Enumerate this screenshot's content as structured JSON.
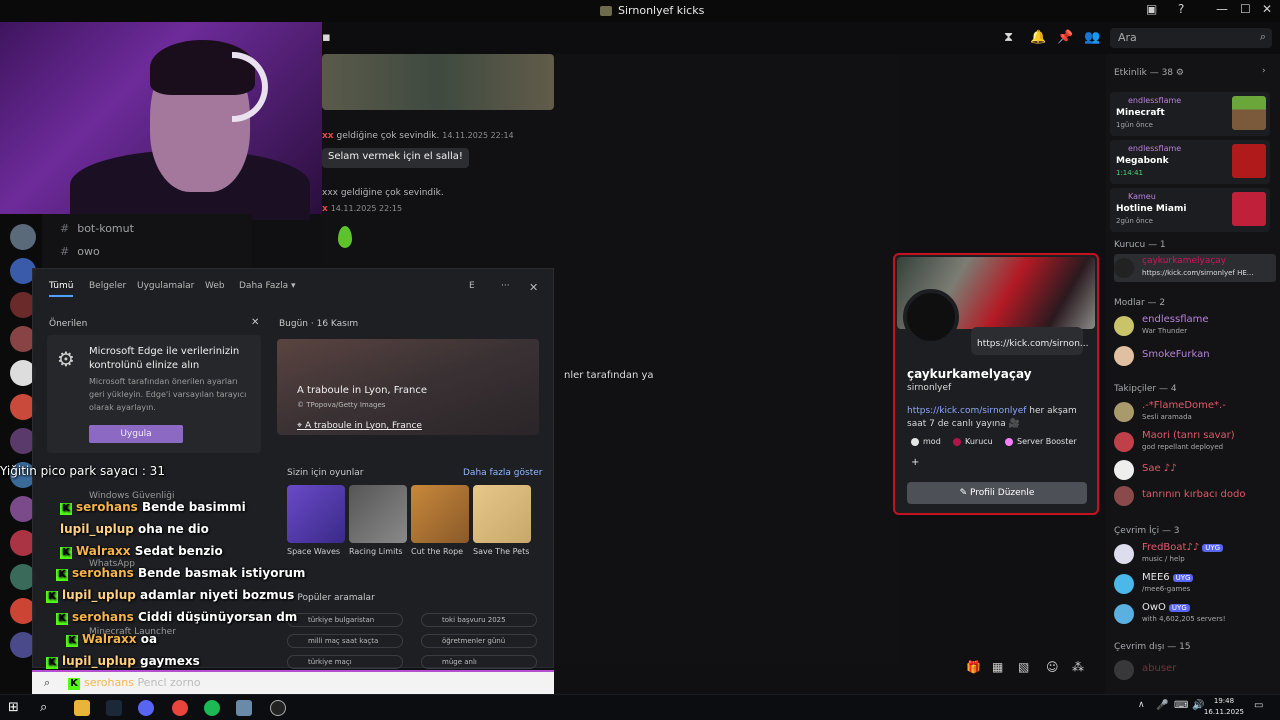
{
  "window": {
    "title": "Sirnonlyef kicks"
  },
  "toolbar": {
    "search_placeholder": "Ara"
  },
  "channels": [
    {
      "name": "bot-komut"
    },
    {
      "name": "owo"
    }
  ],
  "chat": {
    "line1_user": "xx",
    "line1_text": "geldiğine çok sevindik.",
    "line1_time": "14.11.2025 22:14",
    "wave_button": "Selam vermek için el salla!",
    "line2_text": "xxx geldiğine çok sevindik.",
    "line2_time": "14.11.2025 22:15",
    "partial_text": "nler tarafından ya"
  },
  "start_menu": {
    "tabs": [
      "Tümü",
      "Belgeler",
      "Uygulamalar",
      "Web",
      "Daha Fazla"
    ],
    "user_initial": "E",
    "recommended": "Önerilen",
    "edge_title": "Microsoft Edge ile verilerinizin kontrolünü elinize alın",
    "edge_desc": "Microsoft tarafından önerilen ayarları geri yükleyin. Edge'i varsayılan tarayıcı olarak ayarlayın.",
    "edge_button": "Uygula",
    "today": "Bugün",
    "today_date": "16 Kasım",
    "day_caption": "A traboule in Lyon, France",
    "day_credit": "© TPopova/Getty Images",
    "day_location": "A traboule in Lyon, France",
    "games_header": "Sizin için oyunlar",
    "show_more": "Daha fazla göster",
    "games": [
      "Space Waves",
      "Racing Limits",
      "Cut the Rope",
      "Save The Pets"
    ],
    "popular_header": "Popüler aramalar",
    "popular": [
      "türkiye bulgaristan",
      "toki başvuru 2025",
      "milli maç saat kaçta",
      "öğretmenler günü",
      "türkiye maçı",
      "müge anlı"
    ],
    "apps": [
      "Windows Güvenliği",
      "WhatsApp",
      "Minecraft Launcher"
    ]
  },
  "overlay": {
    "counter": "Yiğitin pico park sayacı : 31",
    "messages": [
      {
        "user": "serohans",
        "text": "Bende basimmi"
      },
      {
        "user": "lupil_uplup",
        "text": "oha ne dio"
      },
      {
        "user": "Walraxx",
        "text": "Sedat benzio"
      },
      {
        "user": "serohans",
        "text": "Bende basmak istiyorum"
      },
      {
        "user": "lupil_uplup",
        "text": "adamlar niyeti bozmus"
      },
      {
        "user": "serohans",
        "text": "Ciddi düşünüyorsan dm"
      },
      {
        "user": "Walraxx",
        "text": "oa"
      },
      {
        "user": "lupil_uplup",
        "text": "gaymexs"
      },
      {
        "user": "serohans",
        "text": "Pencl zorno"
      }
    ]
  },
  "profile": {
    "url_bubble": "https://kick.com/sirnon...",
    "display_name": "çaykurkamelyaçay",
    "username": "sirnonlyef",
    "bio_link": "https://kick.com/sirnonlyef",
    "bio_text": " her akşam saat 7 de canlı yayına 🎥",
    "roles": [
      "mod",
      "Kurucu",
      "Server Booster"
    ],
    "add_role": "+",
    "edit_button": "Profili Düzenle"
  },
  "members": {
    "activity_header": "Etkinlik — 38",
    "activities": [
      {
        "user": "endlessflame",
        "game": "Minecraft",
        "time": "1gün önce"
      },
      {
        "user": "endlessflame",
        "game": "Megabonk",
        "time": "1:14:41"
      },
      {
        "user": "Kameu",
        "game": "Hotline Miami",
        "time": "2gün önce"
      }
    ],
    "founder_header": "Kurucu — 1",
    "founder": {
      "name": "çaykurkamelyaçay",
      "sub": "https://kick.com/sirnonlyef HE..."
    },
    "mods_header": "Modlar — 2",
    "mods": [
      {
        "name": "endlessflame",
        "sub": "War Thunder"
      },
      {
        "name": "SmokeFurkan",
        "sub": ""
      }
    ],
    "followers_header": "Takipçiler — 4",
    "followers": [
      {
        "name": ".-*FlameDome*.-",
        "sub": "Sesli aramada"
      },
      {
        "name": "Maori (tanrı savar)",
        "sub": "god repellant deployed"
      },
      {
        "name": "Sae ♪♪",
        "sub": ""
      },
      {
        "name": "tanrının kırbacı dodo",
        "sub": ""
      }
    ],
    "online_header": "Çevrim İçi — 3",
    "online": [
      {
        "name": "FredBoat♪♪",
        "badge": "UYG",
        "sub": "music / help"
      },
      {
        "name": "MEE6",
        "badge": "UYG",
        "sub": "/mee6-games"
      },
      {
        "name": "OwO",
        "badge": "UYG",
        "sub": "with 4,602,205 servers!"
      }
    ],
    "offline_header": "Çevrim dışı — 15",
    "offline": [
      {
        "name": "abuser"
      }
    ]
  },
  "taskbar": {
    "time": "19:48",
    "date": "16.11.2025"
  },
  "colors": {
    "accent": "#c4131f",
    "kick_green": "#53fc18",
    "mod_purple": "#b883d8"
  }
}
